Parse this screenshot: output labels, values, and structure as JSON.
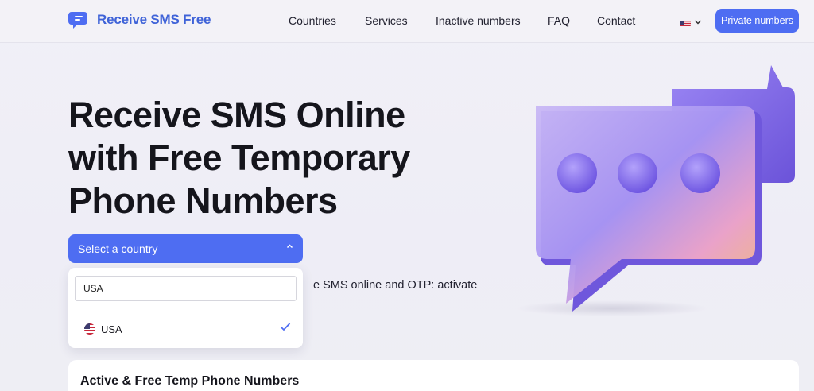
{
  "brand": {
    "name": "Receive SMS Free"
  },
  "nav": [
    {
      "label": "Countries"
    },
    {
      "label": "Services"
    },
    {
      "label": "Inactive numbers"
    },
    {
      "label": "FAQ"
    },
    {
      "label": "Contact"
    }
  ],
  "header": {
    "private_label": "Private numbers",
    "lang_icon": "us-flag-icon"
  },
  "hero": {
    "title_lines": [
      "Receive SMS Online",
      "with Free Temporary",
      "Phone Numbers"
    ],
    "subtitle_visible": "e SMS online and OTP: activate"
  },
  "country_select": {
    "label": "Select a country",
    "search_value": "USA",
    "options": [
      {
        "label": "USA",
        "selected": true
      }
    ]
  },
  "section": {
    "title": "Active & Free Temp Phone Numbers"
  },
  "colors": {
    "accent": "#4e6df2",
    "brand": "#3f63d8",
    "bubble": "#8e7bf0"
  }
}
